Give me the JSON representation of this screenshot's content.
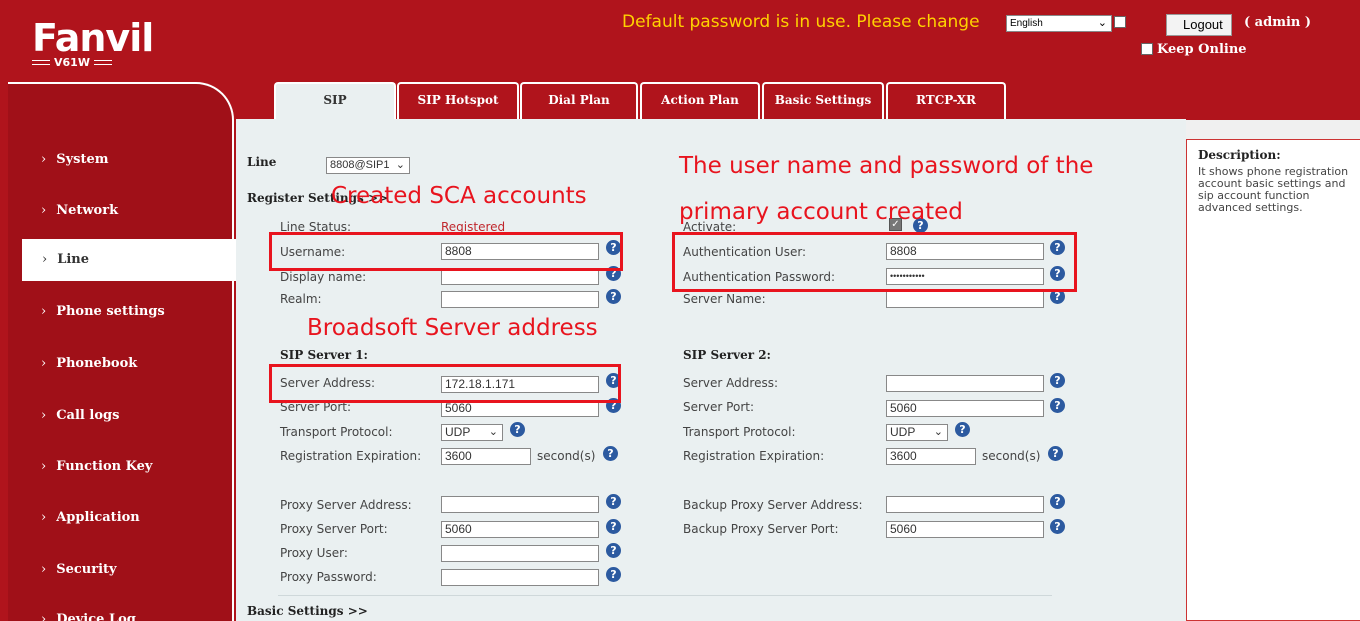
{
  "brand": {
    "name": "Fanvil",
    "model": "V61W"
  },
  "header": {
    "warning": "Default password is in use. Please change",
    "language": "English",
    "logout": "Logout",
    "user": "( admin )",
    "keep_online": "Keep Online"
  },
  "sidebar": {
    "items": [
      {
        "label": "System"
      },
      {
        "label": "Network"
      },
      {
        "label": "Line"
      },
      {
        "label": "Phone settings"
      },
      {
        "label": "Phonebook"
      },
      {
        "label": "Call logs"
      },
      {
        "label": "Function Key"
      },
      {
        "label": "Application"
      },
      {
        "label": "Security"
      },
      {
        "label": "Device Log"
      }
    ],
    "arrow": "›"
  },
  "tabs": [
    "SIP",
    "SIP Hotspot",
    "Dial Plan",
    "Action Plan",
    "Basic Settings",
    "RTCP-XR"
  ],
  "form": {
    "line_label": "Line",
    "line_value": "8808@SIP1",
    "register_settings": "Register Settings >>",
    "line_status_label": "Line Status:",
    "line_status_value": "Registered",
    "username_label": "Username:",
    "username_value": "8808",
    "display_name_label": "Display name:",
    "realm_label": "Realm:",
    "activate_label": "Activate:",
    "auth_user_label": "Authentication User:",
    "auth_user_value": "8808",
    "auth_password_label": "Authentication Password:",
    "auth_password_value": "•••••••••••",
    "server_name_label": "Server Name:",
    "sip_server1": "SIP Server 1:",
    "sip_server2": "SIP Server 2:",
    "server_address_label": "Server Address:",
    "server1_address": "172.18.1.171",
    "server_port_label": "Server Port:",
    "server1_port": "5060",
    "server2_port": "5060",
    "transport_label": "Transport Protocol:",
    "transport1": "UDP",
    "transport2": "UDP",
    "reg_exp_label": "Registration Expiration:",
    "reg_exp1": "3600",
    "reg_exp2": "3600",
    "seconds": "second(s)",
    "proxy_address_label": "Proxy Server Address:",
    "proxy_port_label": "Proxy Server Port:",
    "proxy_port": "5060",
    "proxy_user_label": "Proxy User:",
    "proxy_password_label": "Proxy Password:",
    "backup_proxy_address_label": "Backup Proxy Server Address:",
    "backup_proxy_port_label": "Backup Proxy Server Port:",
    "backup_proxy_port": "5060",
    "basic_settings": "Basic Settings >>"
  },
  "description": {
    "title": "Description:",
    "text": "It shows phone registration account basic settings and sip account function advanced settings."
  },
  "annotations": {
    "sca": "Created SCA accounts",
    "primary_line1": "The user name and password of the",
    "primary_line2": "primary account created",
    "broadsoft": "Broadsoft Server address"
  },
  "colors": {
    "brand_red": "#b0141c",
    "annotation_red": "#e8141e",
    "warning_yellow": "#ffd200",
    "help_blue": "#2c5aa0"
  },
  "icons": {
    "help": "question-circle-icon",
    "dropdown": "chevron-down-icon"
  }
}
